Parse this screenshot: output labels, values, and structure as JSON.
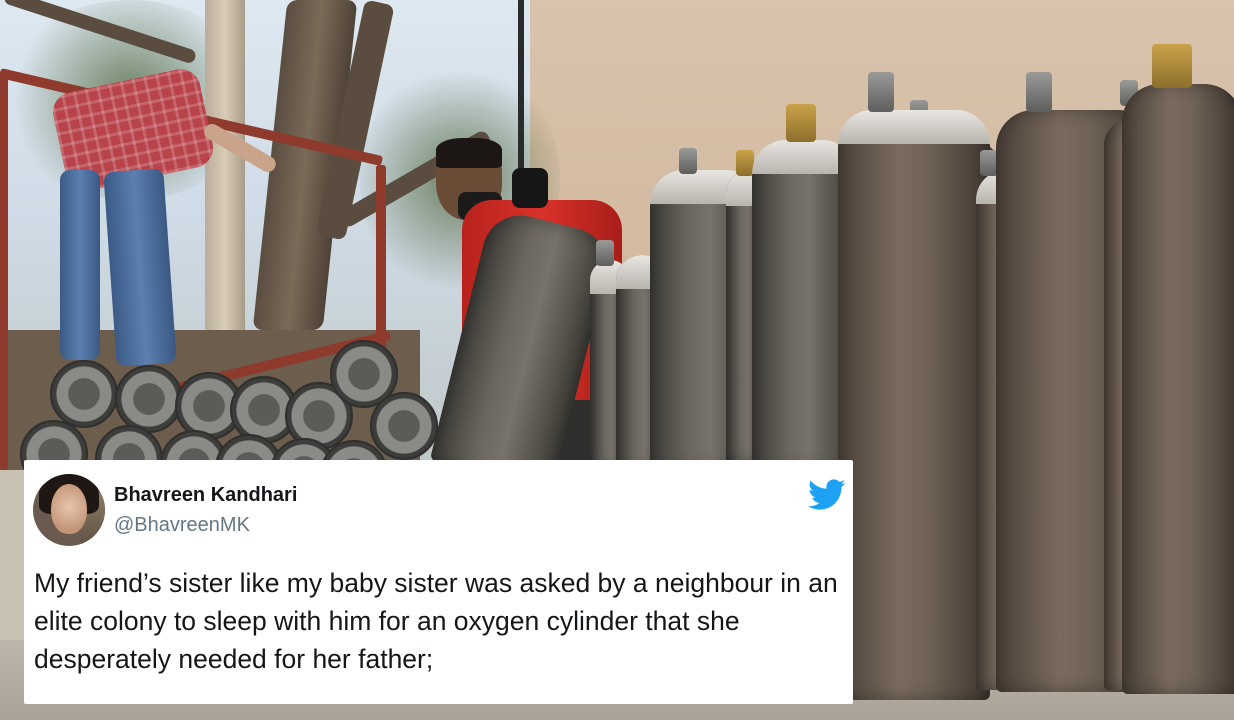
{
  "tweet": {
    "display_name": "Bhavreen Kandhari",
    "handle": "@BhavreenMK",
    "text": "My friend’s sister like my baby sister was asked by a neighbour in an elite colony to sleep with him for an oxygen cylinder that she desperately needed for her father;",
    "platform_icon": "twitter-bird-icon",
    "platform_color": "#1da1f2"
  },
  "photo": {
    "subject": "oxygen-cylinders-photo"
  }
}
